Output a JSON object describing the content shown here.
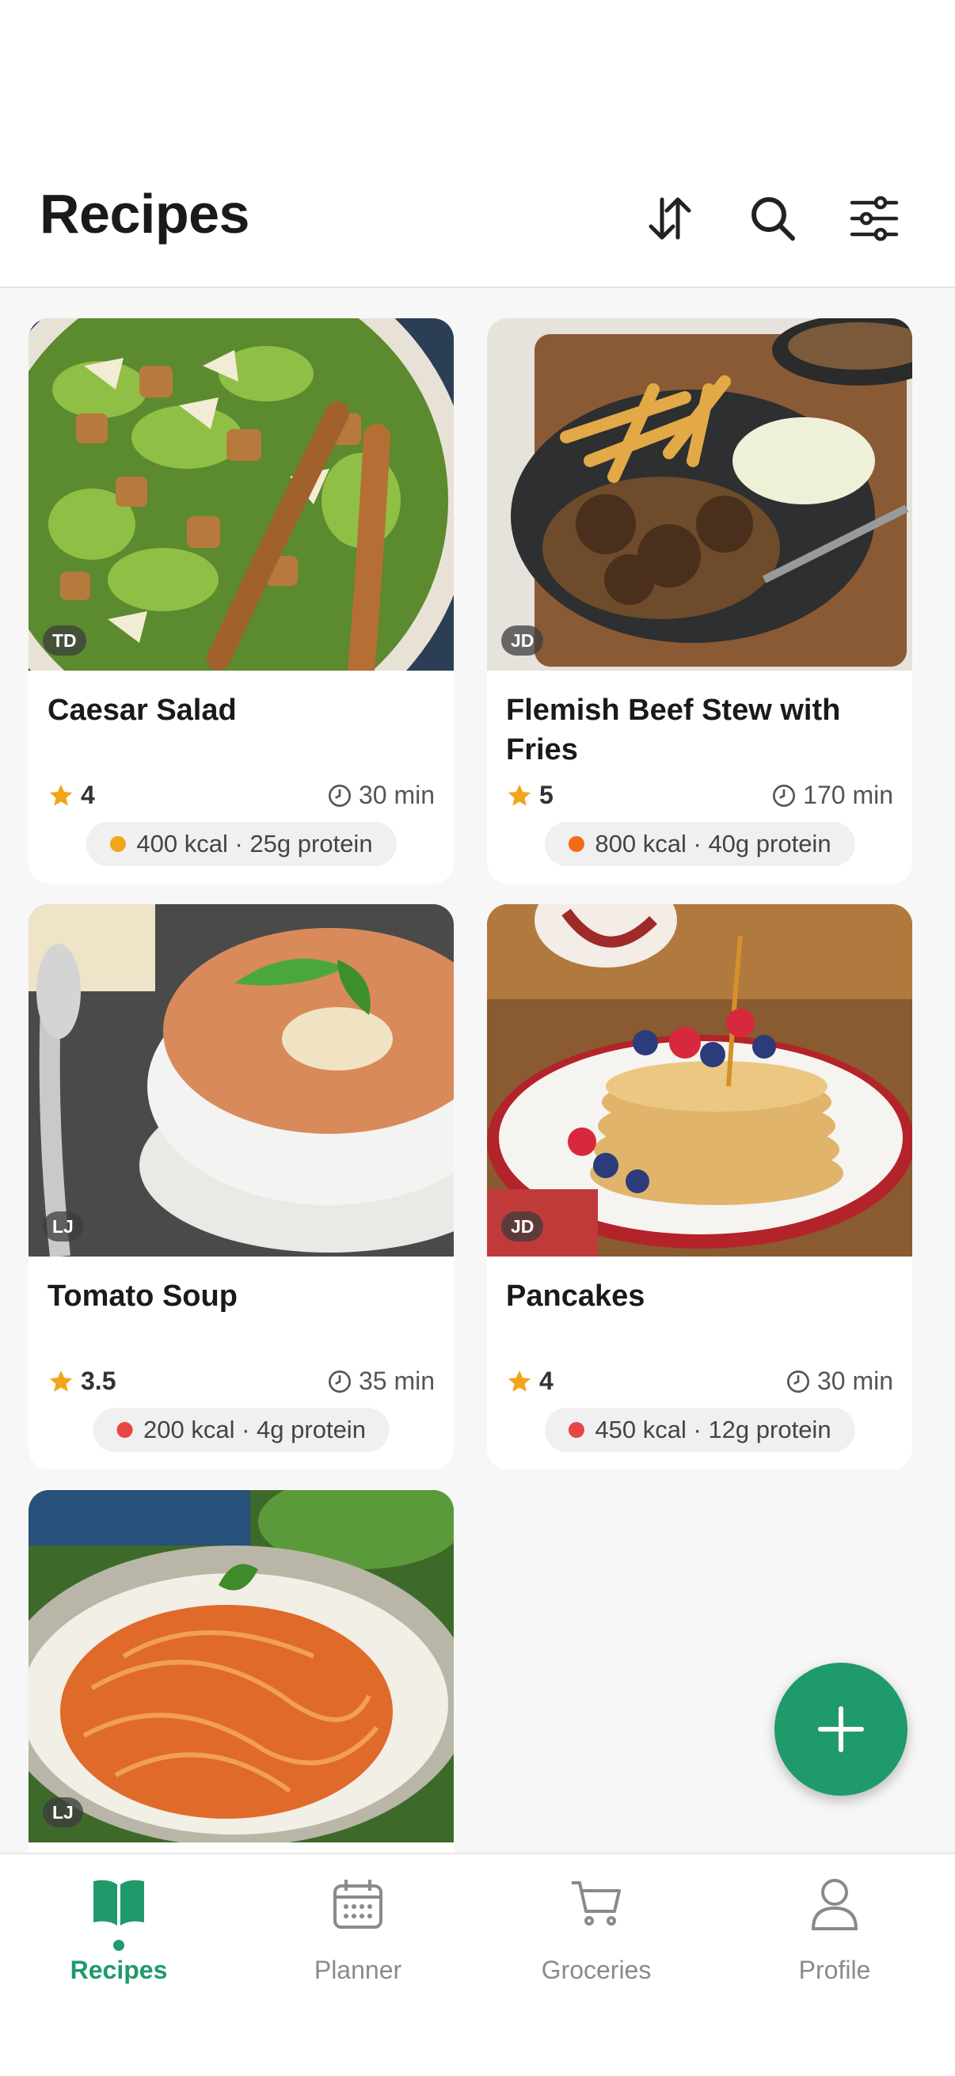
{
  "header": {
    "title": "Recipes"
  },
  "icons": {
    "sort": "sort-icon",
    "search": "search-icon",
    "filter": "filter-sliders-icon",
    "add": "plus-icon"
  },
  "colors": {
    "accent": "#1f9a6a",
    "star": "#f2a51a",
    "orange_dot": "#f2a51a",
    "red_dot": "#e84545"
  },
  "recipes": [
    {
      "name": "Caesar Salad",
      "author": "TD",
      "rating": "4",
      "time": "30 min",
      "nutrition": "400 kcal · 25g protein",
      "dot": "orange"
    },
    {
      "name": "Flemish Beef Stew with Fries",
      "author": "JD",
      "rating": "5",
      "time": "170 min",
      "nutrition": "800 kcal · 40g protein",
      "dot": "orange"
    },
    {
      "name": "Tomato Soup",
      "author": "LJ",
      "rating": "3.5",
      "time": "35 min",
      "nutrition": "200 kcal · 4g protein",
      "dot": "red"
    },
    {
      "name": "Pancakes",
      "author": "JD",
      "rating": "4",
      "time": "30 min",
      "nutrition": "450 kcal · 12g protein",
      "dot": "red"
    },
    {
      "author": "LJ"
    }
  ],
  "nav": [
    {
      "label": "Recipes",
      "icon": "book-icon",
      "active": true
    },
    {
      "label": "Planner",
      "icon": "calendar-icon",
      "active": false
    },
    {
      "label": "Groceries",
      "icon": "cart-icon",
      "active": false
    },
    {
      "label": "Profile",
      "icon": "person-icon",
      "active": false
    }
  ]
}
